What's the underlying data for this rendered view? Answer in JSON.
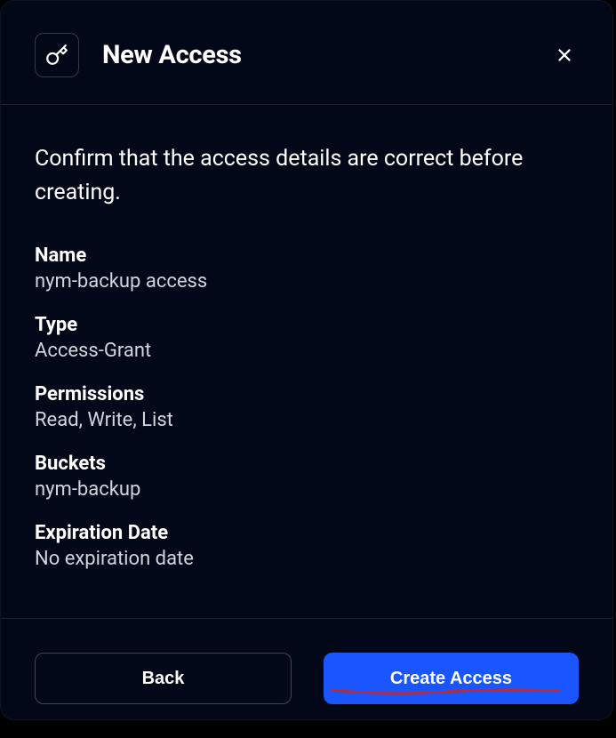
{
  "header": {
    "title": "New Access"
  },
  "body": {
    "confirm_text": "Confirm that the access details are correct before creating.",
    "labels": {
      "name": "Name",
      "type": "Type",
      "permissions": "Permissions",
      "buckets": "Buckets",
      "expiration": "Expiration Date"
    },
    "values": {
      "name": "nym-backup access",
      "type": "Access-Grant",
      "permissions": "Read, Write, List",
      "buckets": "nym-backup",
      "expiration": "No expiration date"
    }
  },
  "footer": {
    "back_label": "Back",
    "create_label": "Create Access"
  }
}
